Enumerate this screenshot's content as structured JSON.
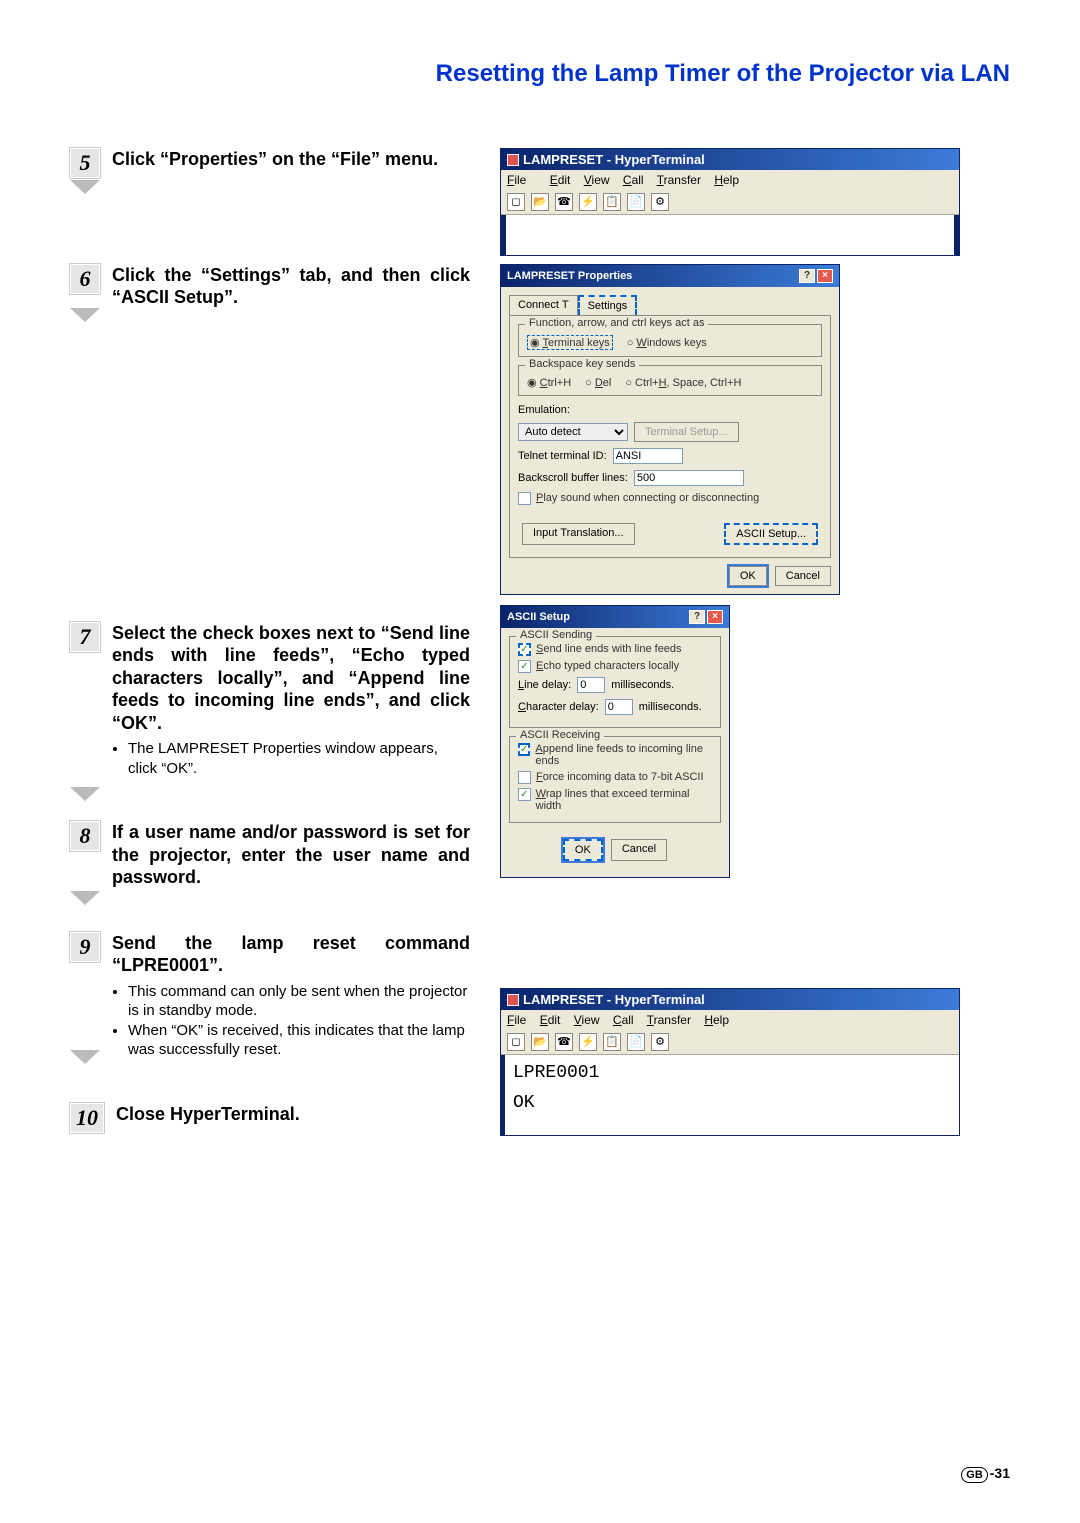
{
  "page_title": "Resetting the Lamp Timer of the Projector via LAN",
  "steps": {
    "s5": {
      "num": "5",
      "title": "Click “Properties” on the “File” menu."
    },
    "s6": {
      "num": "6",
      "title": "Click the “Settings” tab, and then click “ASCII Setup”."
    },
    "s7": {
      "num": "7",
      "title": "Select the check boxes next to “Send line ends with line feeds”, “Echo typed characters locally”, and “Append line feeds to incoming line ends”, and click “OK”.",
      "sub": "The LAMPRESET Properties window appears, click “OK”."
    },
    "s8": {
      "num": "8",
      "title": "If a user name and/or password is set for the projector, enter the user name and password."
    },
    "s9": {
      "num": "9",
      "title": "Send the lamp reset command “LPRE0001”.",
      "sub1": "This command can only be sent when the projector is in standby mode.",
      "sub2": "When “OK” is received, this indicates that the lamp was successfully reset."
    },
    "s10": {
      "num": "10",
      "title": "Close HyperTerminal."
    }
  },
  "ht1": {
    "title": "LAMPRESET - HyperTerminal",
    "menu": {
      "file": "File",
      "edit": "Edit",
      "view": "View",
      "call": "Call",
      "transfer": "Transfer",
      "help": "Help"
    }
  },
  "props_dlg": {
    "title": "LAMPRESET Properties",
    "tab1": "Connect To",
    "tab2": "Settings",
    "group1": "Function, arrow, and ctrl keys act as",
    "opt_terminal": "Terminal keys",
    "opt_windows": "Windows keys",
    "group2": "Backspace key sends",
    "opt_ctrlh": "Ctrl+H",
    "opt_del": "Del",
    "opt_ctrlhspace": "Ctrl+H, Space, Ctrl+H",
    "emulation_lbl": "Emulation:",
    "emulation_val": "Auto detect",
    "term_setup_btn": "Terminal Setup...",
    "telnet_lbl": "Telnet terminal ID:",
    "telnet_val": "ANSI",
    "back_lbl": "Backscroll buffer lines:",
    "back_val": "500",
    "playsound": "Play sound when connecting or disconnecting",
    "input_trans": "Input Translation...",
    "ascii_setup": "ASCII Setup...",
    "ok": "OK",
    "cancel": "Cancel"
  },
  "ascii_dlg": {
    "title": "ASCII Setup",
    "sending": "ASCII Sending",
    "chk1": "Send line ends with line feeds",
    "chk2": "Echo typed characters locally",
    "linedelay_lbl": "Line delay:",
    "linedelay_val": "0",
    "ms": "milliseconds.",
    "chardelay_lbl": "Character delay:",
    "chardelay_val": "0",
    "receiving": "ASCII Receiving",
    "chk3": "Append line feeds to incoming line ends",
    "chk4": "Force incoming data to 7-bit ASCII",
    "chk5": "Wrap lines that exceed terminal width",
    "ok": "OK",
    "cancel": "Cancel"
  },
  "ht2": {
    "title": "LAMPRESET - HyperTerminal",
    "line1": "LPRE0001",
    "line2": "OK"
  },
  "footer": {
    "gb": "GB",
    "pg": "-31"
  }
}
